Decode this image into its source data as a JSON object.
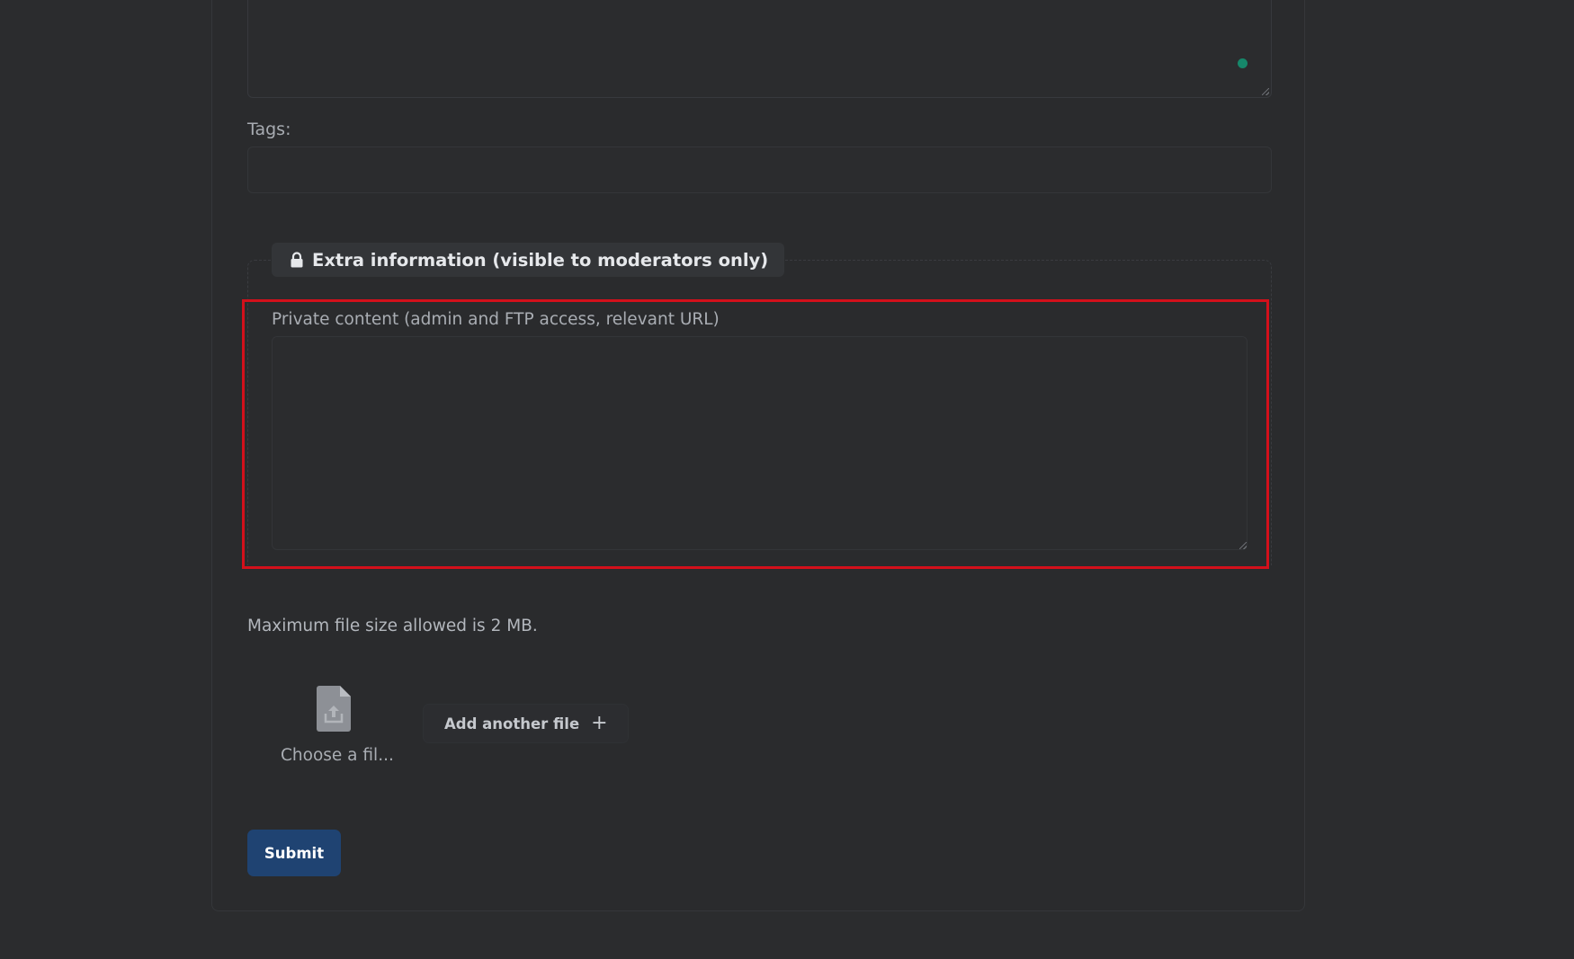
{
  "form": {
    "description_value": "",
    "tags_label": "Tags:",
    "tags_value": "",
    "extra_info_legend": "Extra information (visible to moderators only)",
    "private_content_label": "Private content (admin and FTP access, relevant URL)",
    "private_content_value": "",
    "max_file_size_text": "Maximum file size allowed is 2 MB.",
    "choose_file_label": "Choose a fil...",
    "add_file_label": "Add another file",
    "submit_label": "Submit"
  },
  "icons": {
    "lock": "lock-icon",
    "file_upload": "file-upload-icon",
    "plus": "plus-icon"
  },
  "colors": {
    "background": "#2b2c2e",
    "highlight_border": "#d3101b",
    "submit_button": "#1f4372",
    "grammar_dot": "#16876a"
  }
}
